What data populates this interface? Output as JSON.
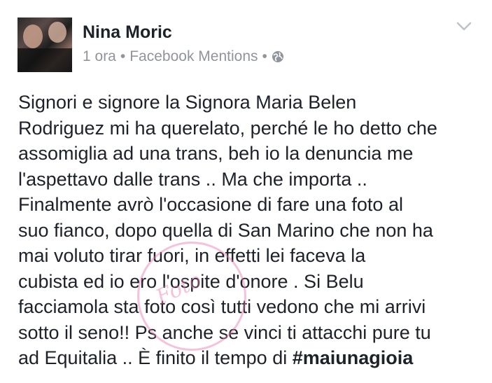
{
  "post": {
    "author": "Nina Moric",
    "time": "1 ora",
    "separator": "•",
    "source": "Facebook Mentions",
    "separator2": "•",
    "text": "Signori e signore la Signora Maria Belen\nRodriguez mi ha querelato, perché le ho detto che\nassomiglia ad una trans, beh io la denuncia me\nl'aspettavo dalle trans .. Ma che importa ..\nFinalmente avrò l'occasione di fare una foto al\nsuo fianco, dopo quella di San Marino che non ha\nmai voluto tirar fuori, in effetti lei faceva la\ncubista ed io ero l'ospite d'onore . Si Belu\nfacciamola sta foto così tutti vedono che mi arrivi\nsotto il seno!! Ps anche se vinci ti attacchi pure tu\nad Equitalia .. È finito il tempo di ",
    "hashtag": "#maiunagioia"
  },
  "watermark": {
    "text": "Foto"
  },
  "icons": {
    "privacy": "globe-icon",
    "menu": "chevron-down-icon"
  },
  "colors": {
    "meta_text": "#90949c",
    "body_text": "#1d2129",
    "watermark": "#e77ab0"
  }
}
